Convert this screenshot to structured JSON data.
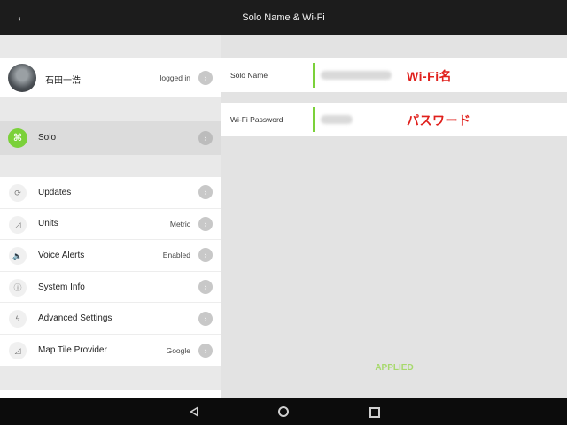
{
  "header": {
    "title": "Solo Name & Wi-Fi",
    "back_icon": "arrow-left-icon"
  },
  "user": {
    "name": "石田一浩",
    "status": "logged in"
  },
  "solo": {
    "label": "Solo"
  },
  "settings": [
    {
      "icon": "refresh-icon",
      "glyph": "⟳",
      "label": "Updates",
      "value": ""
    },
    {
      "icon": "units-icon",
      "glyph": "◿",
      "label": "Units",
      "value": "Metric"
    },
    {
      "icon": "speaker-icon",
      "glyph": "🔈",
      "label": "Voice Alerts",
      "value": "Enabled"
    },
    {
      "icon": "info-icon",
      "glyph": "ⓘ",
      "label": "System Info",
      "value": ""
    },
    {
      "icon": "lightning-icon",
      "glyph": "ϟ",
      "label": "Advanced Settings",
      "value": ""
    },
    {
      "icon": "map-icon",
      "glyph": "◿",
      "label": "Map Tile Provider",
      "value": "Google"
    }
  ],
  "form": {
    "solo_name_label": "Solo Name",
    "solo_name_annotation": "Wi-Fi名",
    "wifi_password_label": "Wi-Fi Password",
    "wifi_password_annotation": "パスワード"
  },
  "status": {
    "applied": "APPLIED"
  },
  "colors": {
    "accent_green": "#7bd13a",
    "annotation_red": "#e0201c",
    "topbar": "#1c1c1c"
  }
}
